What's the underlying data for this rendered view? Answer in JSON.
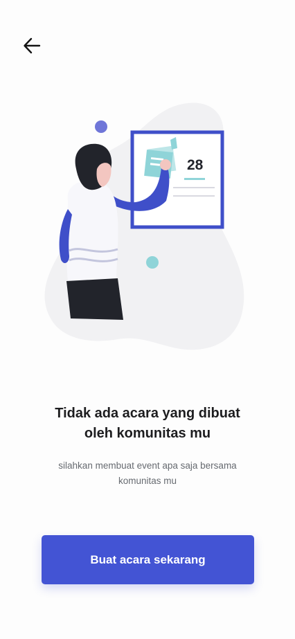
{
  "header": {
    "back_icon": "arrow-left-icon"
  },
  "illustration": {
    "icon": "calendar-presentation-illustration",
    "board_number": "28"
  },
  "empty_state": {
    "title_line1": "Tidak ada acara yang dibuat",
    "title_line2": "oleh komunitas mu",
    "subtitle_line1": "silahkan membuat event apa saja bersama",
    "subtitle_line2": "komunitas mu"
  },
  "cta": {
    "label": "Buat acara sekarang"
  },
  "colors": {
    "accent": "#4354d4",
    "teal": "#7fd3d6",
    "dark": "#1d1d1f"
  }
}
